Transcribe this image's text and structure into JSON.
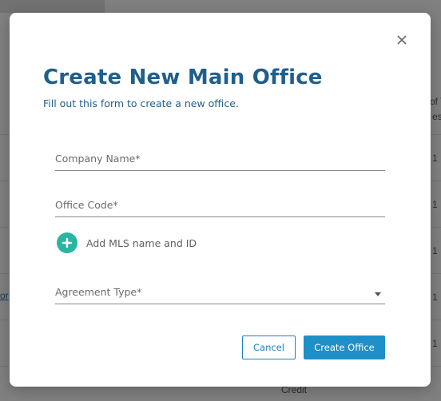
{
  "background": {
    "right_edge_texts": [
      "of T",
      "es",
      "1",
      "1",
      "1",
      "1",
      "1"
    ],
    "left_link": "or",
    "bottom_text": "Credit"
  },
  "modal": {
    "title": "Create New Main Office",
    "subtitle": "Fill out this form to create a new office.",
    "close_icon": "close-icon",
    "fields": {
      "company_name": {
        "label": "Company Name*",
        "value": ""
      },
      "office_code": {
        "label": "Office Code*",
        "value": ""
      },
      "agreement_type": {
        "label": "Agreement Type*",
        "value": ""
      }
    },
    "add_mls": {
      "label": "Add MLS name and ID",
      "icon": "plus-circle-icon"
    },
    "buttons": {
      "cancel": "Cancel",
      "create": "Create Office"
    }
  },
  "colors": {
    "title": "#1f5f8b",
    "add_icon": "#2bb5a0",
    "primary": "#1f8fc7"
  }
}
